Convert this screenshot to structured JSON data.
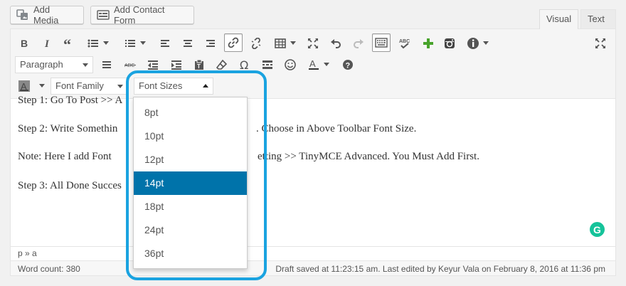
{
  "buttons": {
    "add_media": "Add Media",
    "add_contact_form": "Add Contact Form"
  },
  "tabs": {
    "visual": "Visual",
    "text": "Text"
  },
  "toolbar": {
    "format_select": "Paragraph",
    "font_family": "Font Family",
    "font_sizes": "Font Sizes"
  },
  "content": {
    "line1": "Step 1: Go To Post >> A",
    "line2a": "Step 2: Write Somethin",
    "line2b": ". Choose in Above Toolbar Font Size.",
    "line3a": "Note: Here I add Font",
    "line3b": "etting >> TinyMCE Advanced. You Must Add First.",
    "line4": "Step 3: All Done Succes"
  },
  "font_size_options": [
    "8pt",
    "10pt",
    "12pt",
    "14pt",
    "18pt",
    "24pt",
    "36pt"
  ],
  "selected_font_size": "14pt",
  "path": "p » a",
  "status": {
    "word_count": "Word count: 380",
    "saved": "Draft saved at 11:23:15 am. Last edited by Keyur Vala on February 8, 2016 at 11:36 pm"
  },
  "grammarly_letter": "G",
  "colors": {
    "accent_blue": "#0073aa",
    "highlight_ring": "#1aa3e0",
    "grammarly_green": "#15c39a",
    "add_icon_green": "#48a32b"
  }
}
